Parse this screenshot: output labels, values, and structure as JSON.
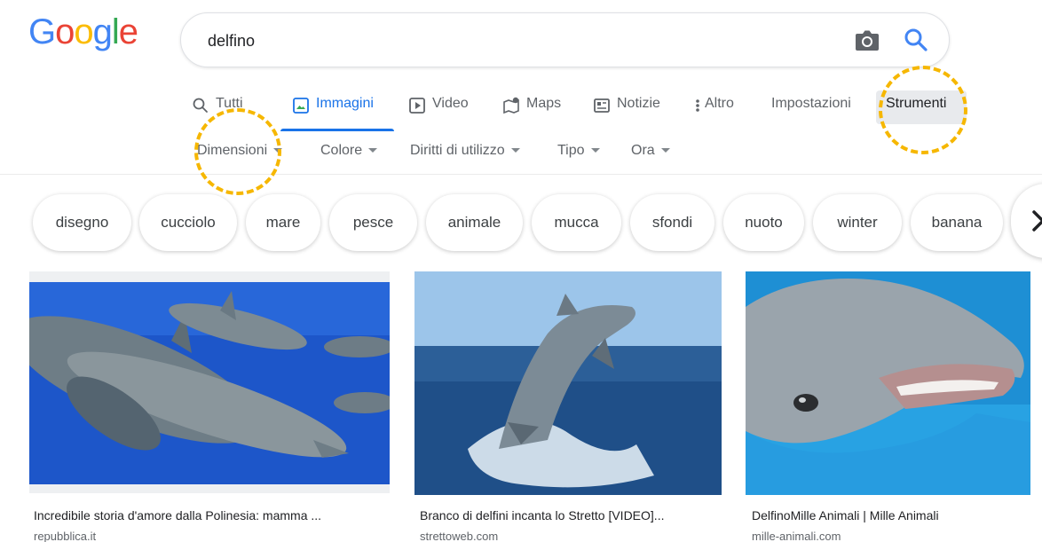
{
  "logo": {
    "letters": [
      "G",
      "o",
      "o",
      "g",
      "l",
      "e"
    ],
    "colors": [
      "#4285f4",
      "#ea4335",
      "#fbbc05",
      "#4285f4",
      "#34a853",
      "#ea4335"
    ]
  },
  "search": {
    "value": "delfino",
    "camera_icon": "camera-icon",
    "search_icon": "search-icon"
  },
  "tabs": [
    {
      "label": "Tutti",
      "icon": "search-icon",
      "active": false
    },
    {
      "label": "Immagini",
      "icon": "image-icon",
      "active": true
    },
    {
      "label": "Video",
      "icon": "play-icon",
      "active": false
    },
    {
      "label": "Maps",
      "icon": "map-pin-icon",
      "active": false
    },
    {
      "label": "Notizie",
      "icon": "news-icon",
      "active": false
    },
    {
      "label": "Altro",
      "icon": "more-vert-icon",
      "active": false
    },
    {
      "label": "Impostazioni",
      "active": false
    },
    {
      "label": "Strumenti",
      "active": false
    }
  ],
  "filters": [
    "Dimensioni",
    "Colore",
    "Diritti di utilizzo",
    "Tipo",
    "Ora"
  ],
  "chips": [
    "disegno",
    "cucciolo",
    "mare",
    "pesce",
    "animale",
    "mucca",
    "sfondi",
    "nuoto",
    "winter",
    "banana"
  ],
  "results": [
    {
      "title": "Incredibile storia d'amore dalla Polinesia: mamma ...",
      "source": "repubblica.it"
    },
    {
      "title": "Branco di delfini incanta lo Stretto [VIDEO]...",
      "source": "strettoweb.com"
    },
    {
      "title": "DelfinoMille Animali | Mille Animali",
      "source": "mille-animali.com"
    }
  ],
  "colors": {
    "accent": "#1a73e8",
    "highlight": "#f6b700",
    "text_secondary": "#5f6368"
  }
}
